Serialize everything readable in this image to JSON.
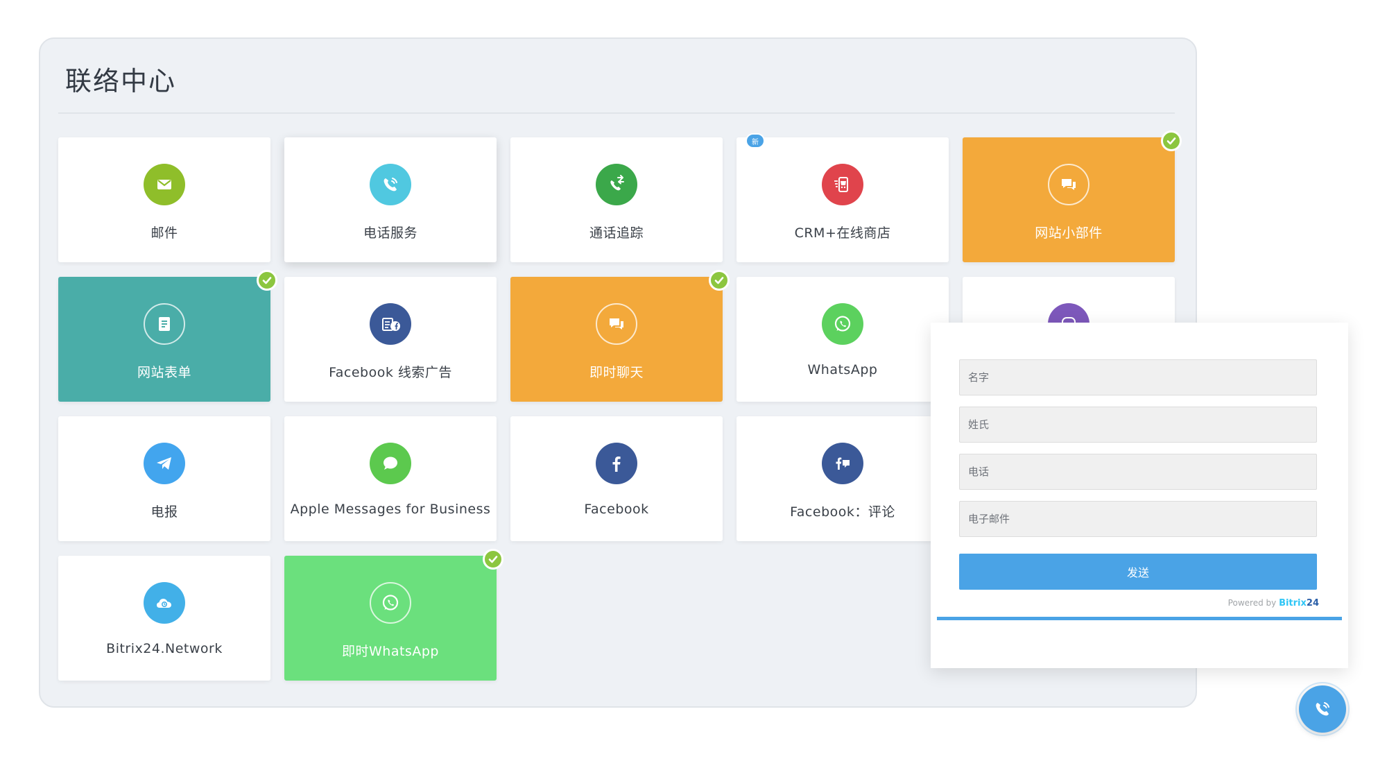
{
  "panel": {
    "title": "联络中心"
  },
  "tiles": [
    {
      "label": "邮件",
      "icon": "mail-icon",
      "color": "#8fbe2a"
    },
    {
      "label": "电话服务",
      "icon": "phone-icon",
      "color": "#50c8e0"
    },
    {
      "label": "通话追踪",
      "icon": "call-tracking-icon",
      "color": "#3ba84a"
    },
    {
      "label": "CRM+在线商店",
      "icon": "store-cart-icon",
      "color": "#e0444c",
      "badge": "新"
    },
    {
      "label": "网站小部件",
      "icon": "chat-bubbles-icon",
      "color": "#f3a93b"
    },
    {
      "label": "网站表单",
      "icon": "form-icon",
      "color": "#4aada8"
    },
    {
      "label": "Facebook 线索广告",
      "icon": "facebook-lead-ads-icon",
      "color": "#3b5998"
    },
    {
      "label": "即时聊天",
      "icon": "chat-bubbles-icon",
      "color": "#f3a93b"
    },
    {
      "label": "WhatsApp",
      "icon": "whatsapp-icon",
      "color": "#5cd15e"
    },
    {
      "label": "电报",
      "icon": "telegram-icon",
      "color": "#42a5ee"
    },
    {
      "label": "Apple Messages for Business",
      "icon": "apple-messages-icon",
      "color": "#5cc94e"
    },
    {
      "label": "Facebook",
      "icon": "facebook-icon",
      "color": "#3b5998"
    },
    {
      "label": "Facebook：评论",
      "icon": "facebook-comments-icon",
      "color": "#3b5998"
    },
    {
      "label": "Bitrix24.Network",
      "icon": "cloud-icon",
      "color": "#42b0e8"
    },
    {
      "label": "即时WhatsApp",
      "icon": "whatsapp-icon",
      "color": "#6be07d"
    }
  ],
  "form": {
    "first_name_placeholder": "名字",
    "last_name_placeholder": "姓氏",
    "phone_placeholder": "电话",
    "email_placeholder": "电子邮件",
    "send_label": "发送",
    "powered_by": "Powered by",
    "brand": "Bitrix",
    "brand_suffix": "24"
  },
  "fab": {
    "icon": "phone-icon"
  }
}
